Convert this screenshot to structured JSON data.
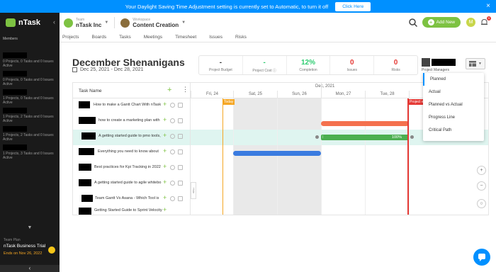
{
  "banner": {
    "text": "Your Daylight Saving Time Adjustment setting is currently set to Automatic, to turn it off",
    "button": "Click Here"
  },
  "brand": {
    "name": "nTask"
  },
  "sidebar": {
    "members_label": "Members",
    "items": [
      {
        "meta": "0 Projects, 0 Tasks and 0 Issues\nActive"
      },
      {
        "meta": "0 Projects, 0 Tasks and 0 Issues\nActive"
      },
      {
        "meta": "1 Projects, 0 Tasks and 0 Issues\nActive"
      },
      {
        "meta": "1 Projects, 2 Tasks and 0 Issues\nActive"
      },
      {
        "meta": "1 Projects, 2 Tasks and 0 Issues\nActive"
      },
      {
        "meta": "1 Projects, 3 Tasks and 0 Issues\nActive"
      }
    ],
    "trial_small": "Team Plan",
    "trial_name": "nTask Business Trial",
    "trial_ends": "Ends on Nov 26, 2022"
  },
  "header": {
    "team_small": "Team",
    "team_name": "nTask Inc",
    "ws_small": "Workspace",
    "ws_name": "Content Creation",
    "add_new": "Add New",
    "user_initial": "M",
    "bell_count": "9"
  },
  "nav": [
    "Projects",
    "Boards",
    "Tasks",
    "Meetings",
    "Timesheet",
    "Issues",
    "Risks"
  ],
  "project": {
    "title": "December Shenanigans",
    "dates": "Dec 25, 2021 - Dec 28, 2021",
    "stats": [
      {
        "value": "-",
        "label": "Project Budget",
        "color": ""
      },
      {
        "value": "-",
        "label": "Project Cost",
        "color": "green"
      },
      {
        "value": "12%",
        "label": "Completion",
        "color": "green"
      },
      {
        "value": "0",
        "label": "Issues",
        "color": "red"
      },
      {
        "value": "0",
        "label": "Risks",
        "color": "red"
      }
    ],
    "managers_label": "Project Managers"
  },
  "gantt": {
    "task_header": "Task Name",
    "tasks": [
      {
        "name": "How to make a Gantt Chart With nTask"
      },
      {
        "name": "how to create a marketing plan with"
      },
      {
        "name": "A getting started guide to pmo tools,"
      },
      {
        "name": "Everything you need to know about"
      },
      {
        "name": "Best practices for Kpi Tracking in 2022"
      },
      {
        "name": "A getting started guide to agile whitebo"
      },
      {
        "name": "Team Gantt Vs Asana - Which Tool is"
      },
      {
        "name": "Getting Started Guide to Sprint Velocity"
      }
    ],
    "month_left": "Dec, 2021",
    "month_right": "Dec, 2021",
    "days": [
      "Fri, 24",
      "Sat, 25",
      "Sun, 26",
      "Mon, 27",
      "Tue, 28",
      "W"
    ],
    "today_label": "Today",
    "project_end_label": "Project e",
    "progress_label": "100%",
    "side_tab": "Hide"
  },
  "view_menu": [
    "Planned",
    "Actual",
    "Planned vs Actual",
    "Progress Line",
    "Critical Path"
  ],
  "colors": {
    "accent": "#0090ff",
    "brand": "#7dc242",
    "bar_orange": "#f4714e",
    "bar_blue": "#3a7be0",
    "bar_green": "#4caf50"
  }
}
